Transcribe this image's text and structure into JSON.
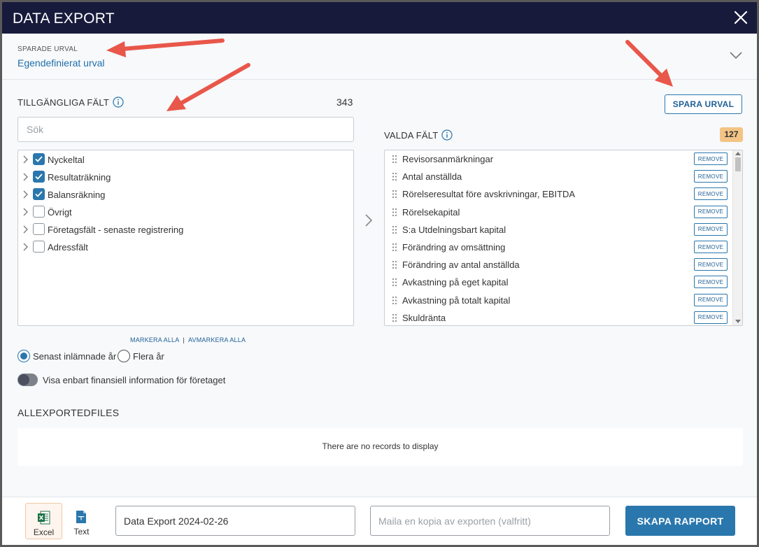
{
  "dialog": {
    "title": "DATA EXPORT"
  },
  "saved_selection": {
    "label": "SPARADE URVAL",
    "value": "Egendefinierat urval"
  },
  "available": {
    "heading": "TILLGÄNGLIGA FÄLT",
    "count": "343",
    "search_placeholder": "Sök",
    "items": [
      {
        "label": "Nyckeltal",
        "checked": true
      },
      {
        "label": "Resultaträkning",
        "checked": true
      },
      {
        "label": "Balansräkning",
        "checked": true
      },
      {
        "label": "Övrigt",
        "checked": false
      },
      {
        "label": "Företagsfält - senaste registrering",
        "checked": false
      },
      {
        "label": "Adressfält",
        "checked": false
      }
    ],
    "select_all": "MARKERA ALLA",
    "deselect_all": "AVMARKERA ALLA",
    "separator": "|"
  },
  "selected": {
    "heading": "VALDA FÄLT",
    "count": "127",
    "save_button": "SPARA URVAL",
    "remove_label": "REMOVE",
    "items": [
      "Revisorsanmärkningar",
      "Antal anställda",
      "Rörelseresultat före avskrivningar, EBITDA",
      "Rörelsekapital",
      "S:a Utdelningsbart kapital",
      "Förändring av omsättning",
      "Förändring av antal anställda",
      "Avkastning på eget kapital",
      "Avkastning på totalt kapital",
      "Skuldränta"
    ]
  },
  "options": {
    "radio_latest": "Senast inlämnade år",
    "radio_multiple": "Flera år",
    "selected_radio": "latest",
    "toggle_label": "Visa enbart finansiell information för företaget",
    "toggle_on": false
  },
  "exports": {
    "heading": "ALLEXPORTEDFILES",
    "empty_message": "There are no records to display"
  },
  "footer": {
    "format_excel": "Excel",
    "format_text": "Text",
    "selected_format": "excel",
    "report_name": "Data Export 2024-02-26",
    "email_placeholder": "Maila en kopia av exporten (valfritt)",
    "create_button": "SKAPA RAPPORT"
  },
  "colors": {
    "titlebar": "#171a3b",
    "accent": "#2a77ad",
    "badge": "#f3c485",
    "annotation_arrow": "#e8574a"
  }
}
